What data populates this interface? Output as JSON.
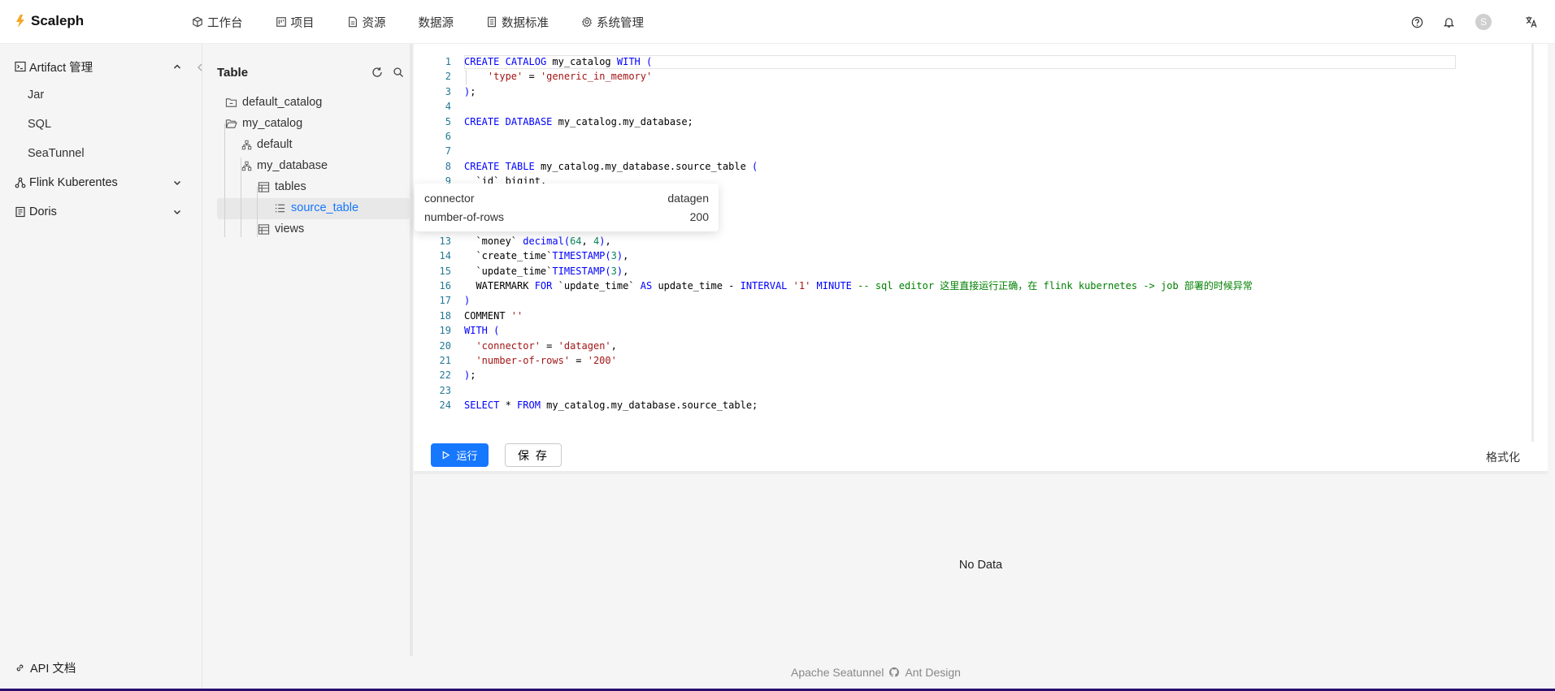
{
  "app": {
    "name": "Scaleph"
  },
  "nav": [
    {
      "label": "工作台",
      "icon": "cube-icon"
    },
    {
      "label": "项目",
      "icon": "project-icon"
    },
    {
      "label": "资源",
      "icon": "file-icon"
    },
    {
      "label": "数据源",
      "icon": ""
    },
    {
      "label": "数据标准",
      "icon": "list-doc-icon"
    },
    {
      "label": "系统管理",
      "icon": "gear-icon"
    }
  ],
  "topbar": {
    "avatar_initial": "S"
  },
  "sidebar": {
    "artifact": {
      "label": "Artifact 管理",
      "children": [
        "Jar",
        "SQL",
        "SeaTunnel"
      ]
    },
    "flink": {
      "label": "Flink Kuberentes"
    },
    "doris": {
      "label": "Doris"
    },
    "api_doc": "API 文档"
  },
  "tree": {
    "title": "Table",
    "nodes": {
      "default_catalog": "default_catalog",
      "my_catalog": "my_catalog",
      "default": "default",
      "my_database": "my_database",
      "tables": "tables",
      "source_table": "source_table",
      "views": "views"
    }
  },
  "editor": {
    "lines": [
      "CREATE CATALOG my_catalog WITH (",
      "    'type' = 'generic_in_memory'",
      ");",
      "",
      "CREATE DATABASE my_catalog.my_database;",
      "",
      "",
      "CREATE TABLE my_catalog.my_database.source_table (",
      "  `id` bigint,",
      "",
      "",
      "",
      "  `money` decimal(64, 4),",
      "  `create_time`TIMESTAMP(3),",
      "  `update_time`TIMESTAMP(3),",
      "  WATERMARK FOR `update_time` AS update_time - INTERVAL '1' MINUTE -- sql editor 这里直接运行正确，在 flink kubernetes -> job 部署的时候异常",
      ")",
      "COMMENT ''",
      "WITH (",
      "  'connector' = 'datagen',",
      "  'number-of-rows' = '200'",
      ");",
      "",
      "SELECT * FROM my_catalog.my_database.source_table;"
    ],
    "run_label": "运行",
    "save_label": "保 存",
    "format_label": "格式化"
  },
  "tooltip": {
    "rows": [
      {
        "key": "connector",
        "value": "datagen"
      },
      {
        "key": "number-of-rows",
        "value": "200"
      }
    ]
  },
  "results": {
    "empty_text": "No Data"
  },
  "footer": {
    "left": "Apache Seatunnel",
    "right": "Ant Design"
  }
}
